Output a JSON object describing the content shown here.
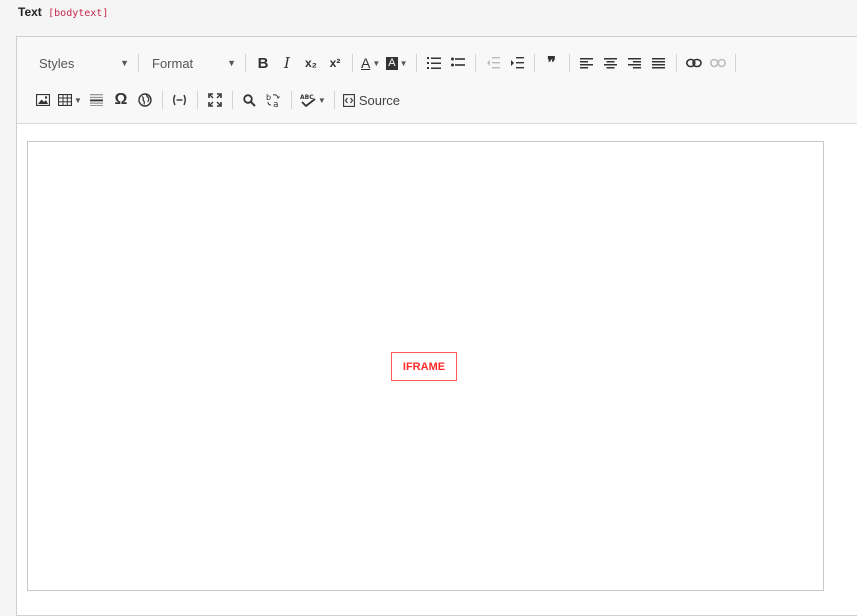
{
  "field": {
    "label": "Text",
    "code": "[bodytext]"
  },
  "toolbar": {
    "row1": {
      "styles_label": "Styles",
      "format_label": "Format",
      "buttons": [
        {
          "name": "bold",
          "glyph": "B"
        },
        {
          "name": "italic",
          "glyph": "I"
        },
        {
          "name": "subscript",
          "glyph": "x₂"
        },
        {
          "name": "superscript",
          "glyph": "x²"
        },
        {
          "name": "text-color",
          "glyph": "A"
        },
        {
          "name": "background-color",
          "glyph": "A"
        },
        {
          "name": "numbered-list",
          "glyph": ""
        },
        {
          "name": "bulleted-list",
          "glyph": ""
        },
        {
          "name": "decrease-indent",
          "glyph": ""
        },
        {
          "name": "increase-indent",
          "glyph": ""
        },
        {
          "name": "blockquote",
          "glyph": "❞"
        },
        {
          "name": "align-left",
          "glyph": ""
        },
        {
          "name": "align-center",
          "glyph": ""
        },
        {
          "name": "align-right",
          "glyph": ""
        },
        {
          "name": "justify",
          "glyph": ""
        },
        {
          "name": "link",
          "glyph": ""
        },
        {
          "name": "unlink",
          "glyph": ""
        }
      ]
    },
    "row2": {
      "special_char_glyph": "Ω",
      "source_label": "Source"
    }
  },
  "content": {
    "placeholder_label": "IFRAME"
  },
  "colors": {
    "accent_code": "#c7254e",
    "placeholder_border": "#ff5b5b",
    "placeholder_text": "#ff2b2b"
  }
}
